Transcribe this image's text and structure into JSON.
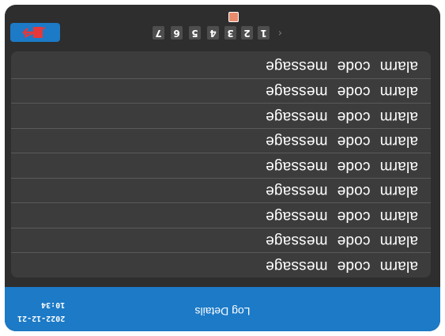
{
  "header": {
    "title": "Log Details",
    "date": "2022-12-21",
    "time": "10:34"
  },
  "log_rows": [
    {
      "alarm": "alarm",
      "code": "code",
      "message": "message"
    },
    {
      "alarm": "alarm",
      "code": "code",
      "message": "message"
    },
    {
      "alarm": "alarm",
      "code": "code",
      "message": "message"
    },
    {
      "alarm": "alarm",
      "code": "code",
      "message": "message"
    },
    {
      "alarm": "alarm",
      "code": "code",
      "message": "message"
    },
    {
      "alarm": "alarm",
      "code": "code",
      "message": "message"
    },
    {
      "alarm": "alarm",
      "code": "code",
      "message": "message"
    },
    {
      "alarm": "alarm",
      "code": "code",
      "message": "message"
    },
    {
      "alarm": "alarm",
      "code": "code",
      "message": "message"
    }
  ],
  "pagination": {
    "pages": [
      "1",
      "2",
      "3",
      "4",
      "5",
      "6",
      "7"
    ],
    "prev_icon": "chevron-left-icon",
    "exit_icon": "exit-door-icon",
    "image_icon": "image-icon"
  },
  "colors": {
    "screen_background": "#2e2e2e",
    "header_blue": "#1c7ac7",
    "list_background": "#3c3c3c",
    "page_button": "#4e4e4e",
    "exit_icon_red": "#e5383b"
  }
}
